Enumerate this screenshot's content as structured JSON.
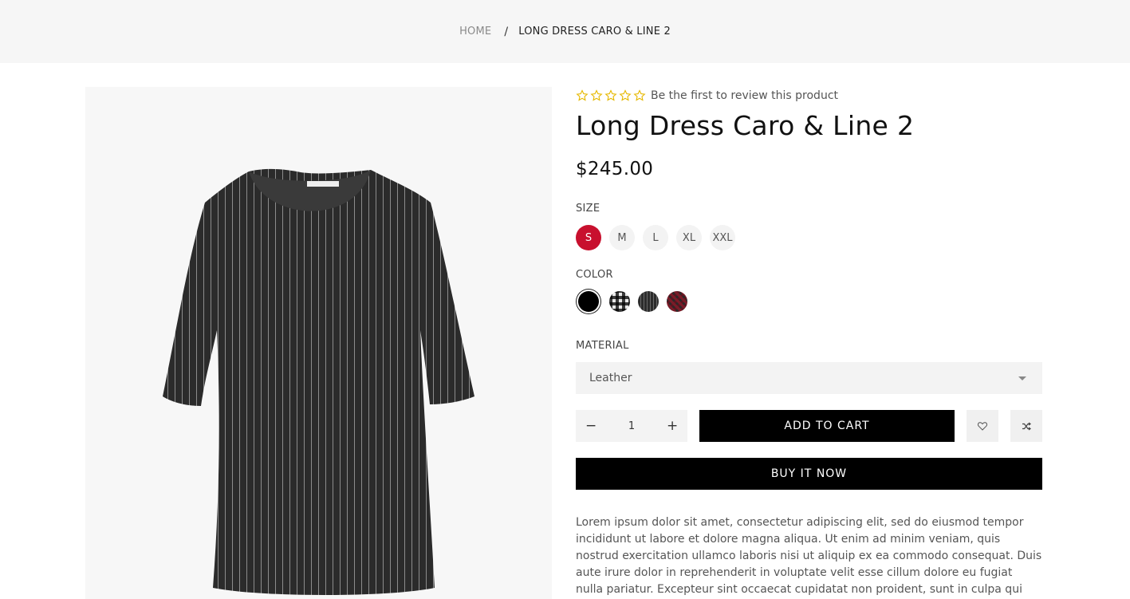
{
  "breadcrumb": {
    "home": "HOME",
    "separator": "/",
    "current": "LONG DRESS CARO & LINE 2"
  },
  "product": {
    "image_alt": "Black pinstripe long dress",
    "rating": 0,
    "rating_max": 5,
    "review_text": "Be the first to review this product",
    "title": "Long Dress Caro & Line 2",
    "price": "$245.00"
  },
  "options": {
    "size_label": "SIZE",
    "sizes": [
      "S",
      "M",
      "L",
      "XL",
      "XXL"
    ],
    "selected_size": "S",
    "color_label": "COLOR",
    "colors": [
      "black",
      "check",
      "stripe",
      "red-check"
    ],
    "material_label": "MATERIAL",
    "material_value": "Leather"
  },
  "cart": {
    "quantity": "1",
    "minus": "−",
    "plus": "+",
    "add_to_cart": "ADD TO CART",
    "buy_now": "BUY IT NOW",
    "wishlist_icon": "heart-icon",
    "compare_icon": "shuffle-icon"
  },
  "description": "Lorem ipsum dolor sit amet, consectetur adipiscing elit, sed do eiusmod tempor incididunt ut labore et dolore magna aliqua. Ut enim ad minim veniam, quis nostrud exercitation ullamco laboris nisi ut aliquip ex ea commodo consequat. Duis aute irure dolor in reprehenderit in voluptate velit esse cillum dolore eu fugiat nulla pariatur. Excepteur sint occaecat cupidatat non proident, sunt in culpa qui",
  "colors_theme": {
    "accent": "#c8102e",
    "star": "#e6b800",
    "button": "#000000",
    "breadcrumb_bg": "#f6f6f6"
  }
}
